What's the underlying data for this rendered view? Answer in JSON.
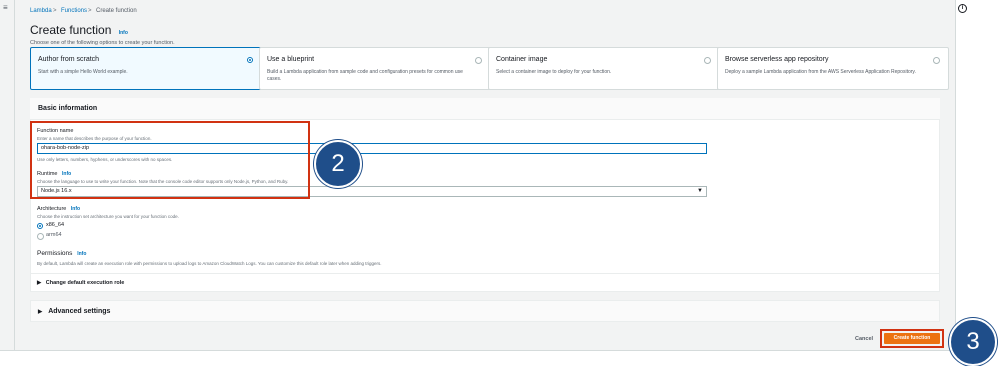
{
  "breadcrumb": {
    "items": [
      "Lambda",
      "Functions",
      "Create function"
    ],
    "separator": ">"
  },
  "page": {
    "title": "Create function",
    "title_info": "Info",
    "subtitle": "Choose one of the following options to create your function."
  },
  "options": [
    {
      "title": "Author from scratch",
      "desc": "Start with a simple Hello World example.",
      "selected": true
    },
    {
      "title": "Use a blueprint",
      "desc": "Build a Lambda application from sample code and configuration presets for common use cases.",
      "selected": false
    },
    {
      "title": "Container image",
      "desc": "Select a container image to deploy for your function.",
      "selected": false
    },
    {
      "title": "Browse serverless app repository",
      "desc": "Deploy a sample Lambda application from the AWS Serverless Application Repository.",
      "selected": false
    }
  ],
  "basic": {
    "title": "Basic information",
    "function_name_label": "Function name",
    "function_name_hint": "Enter a name that describes the purpose of your function.",
    "function_name_value": "ohara-bob-node-zip",
    "function_name_constraint": "Use only letters, numbers, hyphens, or underscores with no spaces.",
    "runtime_label": "Runtime",
    "runtime_info": "Info",
    "runtime_hint": "Choose the language to use to write your function. Note that the console code editor supports only Node.js, Python, and Ruby.",
    "runtime_value": "Node.js 16.x",
    "architecture_label": "Architecture",
    "architecture_info": "Info",
    "architecture_hint": "Choose the instruction set architecture you want for your function code.",
    "architecture_options": [
      "x86_64",
      "arm64"
    ],
    "permissions_label": "Permissions",
    "permissions_info": "Info",
    "permissions_hint": "By default, Lambda will create an execution role with permissions to upload logs to Amazon CloudWatch Logs. You can customize this default role later when adding triggers.",
    "change_role": "Change default execution role"
  },
  "advanced": {
    "label": "Advanced settings"
  },
  "footer": {
    "cancel": "Cancel",
    "create": "Create function"
  },
  "callouts": {
    "step2": "2",
    "step3": "3"
  },
  "icons": {
    "menu": "hamburger-icon",
    "info": "info-icon",
    "caret": "caret-down-icon"
  },
  "colors": {
    "accent": "#0073bb",
    "primary_button": "#ec7211",
    "highlight": "#d13212",
    "callout": "#1f4e8a"
  }
}
